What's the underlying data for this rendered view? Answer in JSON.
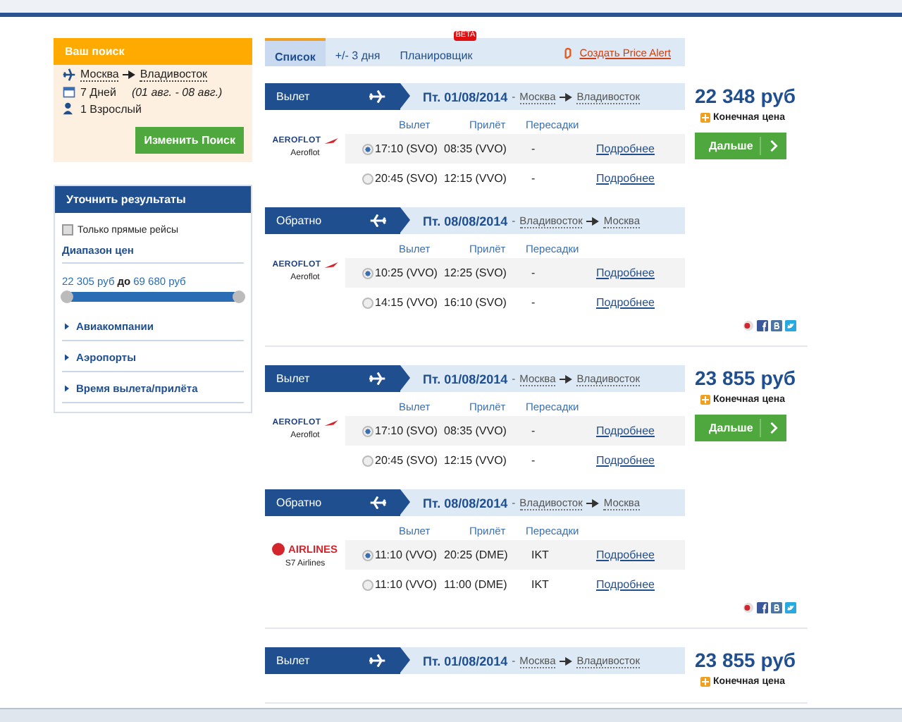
{
  "search": {
    "title": "Ваш поиск",
    "from": "Москва",
    "to": "Владивосток",
    "duration": "7 Дней",
    "dates": "(01 авг. - 08 авг.)",
    "passengers": "1 Взрослый",
    "button": "Изменить Поиск"
  },
  "refine": {
    "title": "Уточнить результаты",
    "direct_only": {
      "label": "Только прямые рейсы",
      "checked": false
    },
    "price_range_title": "Диапазон цен",
    "price_min": "22 305 руб",
    "price_sep": "до",
    "price_max": "69 680 руб",
    "price_slider": {
      "level": 1
    },
    "sections": [
      "Авиакомпании",
      "Аэропорты",
      "Время вылета/прилёта"
    ]
  },
  "tabs": [
    {
      "label": "Список",
      "selected": true
    },
    {
      "label": "+/- 3 дня",
      "selected": false
    },
    {
      "label": "Планировщик",
      "selected": false,
      "badge": "BETA"
    }
  ],
  "price_alert": "Создать Price Alert",
  "offers": [
    {
      "price": "22 348 руб",
      "final_label": "Конечная цена",
      "next_button": "Дальше",
      "share": true,
      "legs": [
        {
          "kind": "out",
          "direction": "Вылет",
          "date": "Пт. 01/08/2014",
          "separator": "-",
          "from": "Москва",
          "to": "Владивосток",
          "columns": [
            "Вылет",
            "Прилёт",
            "Пересадки"
          ],
          "airline": {
            "kind": "aeroflot",
            "logo_text": "AEROFLOT",
            "name": "Aeroflot"
          },
          "flights": [
            {
              "selected": true,
              "dep": "17:10 (SVO)",
              "arr": "08:35 (VVO)",
              "transfers": "-",
              "link": "Подробнее"
            },
            {
              "selected": false,
              "dep": "20:45 (SVO)",
              "arr": "12:15 (VVO)",
              "transfers": "-",
              "link": "Подробнее"
            }
          ]
        },
        {
          "kind": "back",
          "direction": "Обратно",
          "date": "Пт. 08/08/2014",
          "separator": "-",
          "from": "Владивосток",
          "to": "Москва",
          "columns": [
            "Вылет",
            "Прилёт",
            "Пересадки"
          ],
          "airline": {
            "kind": "aeroflot",
            "logo_text": "AEROFLOT",
            "name": "Aeroflot"
          },
          "flights": [
            {
              "selected": true,
              "dep": "10:25 (VVO)",
              "arr": "12:25 (SVO)",
              "transfers": "-",
              "link": "Подробнее"
            },
            {
              "selected": false,
              "dep": "14:15 (VVO)",
              "arr": "16:10 (SVO)",
              "transfers": "-",
              "link": "Подробнее"
            }
          ]
        }
      ]
    },
    {
      "price": "23 855 руб",
      "final_label": "Конечная цена",
      "next_button": "Дальше",
      "share": true,
      "legs": [
        {
          "kind": "out",
          "direction": "Вылет",
          "date": "Пт. 01/08/2014",
          "separator": "-",
          "from": "Москва",
          "to": "Владивосток",
          "columns": [
            "Вылет",
            "Прилёт",
            "Пересадки"
          ],
          "airline": {
            "kind": "aeroflot",
            "logo_text": "AEROFLOT",
            "name": "Aeroflot"
          },
          "flights": [
            {
              "selected": true,
              "dep": "17:10 (SVO)",
              "arr": "08:35 (VVO)",
              "transfers": "-",
              "link": "Подробнее"
            },
            {
              "selected": false,
              "dep": "20:45 (SVO)",
              "arr": "12:15 (VVO)",
              "transfers": "-",
              "link": "Подробнее"
            }
          ]
        },
        {
          "kind": "back",
          "direction": "Обратно",
          "date": "Пт. 08/08/2014",
          "separator": "-",
          "from": "Владивосток",
          "to": "Москва",
          "columns": [
            "Вылет",
            "Прилёт",
            "Пересадки"
          ],
          "airline": {
            "kind": "s7",
            "logo_text": "AIRLINES",
            "name": "S7 Airlines"
          },
          "flights": [
            {
              "selected": true,
              "dep": "11:10 (VVO)",
              "arr": "20:25 (DME)",
              "transfers": "IKT",
              "link": "Подробнее"
            },
            {
              "selected": false,
              "dep": "11:10 (VVO)",
              "arr": "11:00 (DME)",
              "transfers": "IKT",
              "link": "Подробнее"
            }
          ]
        }
      ]
    },
    {
      "price": "23 855 руб",
      "final_label": "Конечная цена",
      "share": false,
      "legs": [
        {
          "kind": "out",
          "direction": "Вылет",
          "date": "Пт. 01/08/2014",
          "separator": "-",
          "from": "Москва",
          "to": "Владивосток"
        }
      ]
    }
  ]
}
